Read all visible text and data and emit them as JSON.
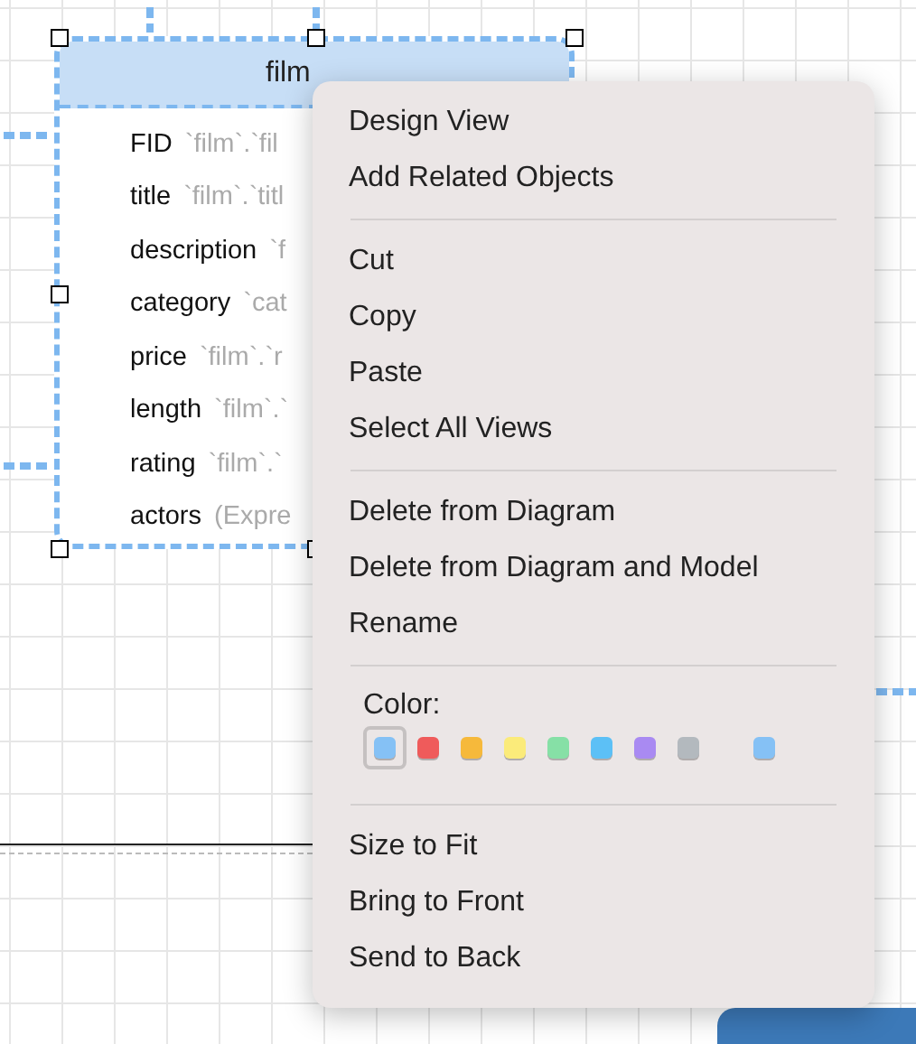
{
  "table": {
    "title": "film",
    "fields": [
      {
        "name": "FID",
        "source": "`film`.`fil"
      },
      {
        "name": "title",
        "source": "`film`.`titl"
      },
      {
        "name": "description",
        "source": "`f"
      },
      {
        "name": "category",
        "source": "`cat"
      },
      {
        "name": "price",
        "source": "`film`.`r"
      },
      {
        "name": "length",
        "source": "`film`.`"
      },
      {
        "name": "rating",
        "source": "`film`.`"
      },
      {
        "name": "actors",
        "source": "(Expre"
      }
    ]
  },
  "context_menu": {
    "groups": [
      {
        "kind": "items",
        "items": [
          "Design View",
          "Add Related Objects"
        ]
      },
      {
        "kind": "items",
        "items": [
          "Cut",
          "Copy",
          "Paste",
          "Select All Views"
        ]
      },
      {
        "kind": "items",
        "items": [
          "Delete from Diagram",
          "Delete from Diagram and Model",
          "Rename"
        ]
      },
      {
        "kind": "colors",
        "label": "Color:",
        "swatches": [
          {
            "color": "#85c1f5",
            "selected": true
          },
          {
            "color": "#ef5b5b",
            "selected": false
          },
          {
            "color": "#f6b93b",
            "selected": false
          },
          {
            "color": "#fbeb7a",
            "selected": false
          },
          {
            "color": "#86e0a6",
            "selected": false
          },
          {
            "color": "#5cc0f6",
            "selected": false
          },
          {
            "color": "#a98af2",
            "selected": false
          },
          {
            "color": "#b3b9be",
            "selected": false
          },
          {
            "color": "#85c1f5",
            "selected": false
          }
        ]
      },
      {
        "kind": "items",
        "items": [
          "Size to Fit",
          "Bring to Front",
          "Send to Back"
        ]
      }
    ]
  }
}
